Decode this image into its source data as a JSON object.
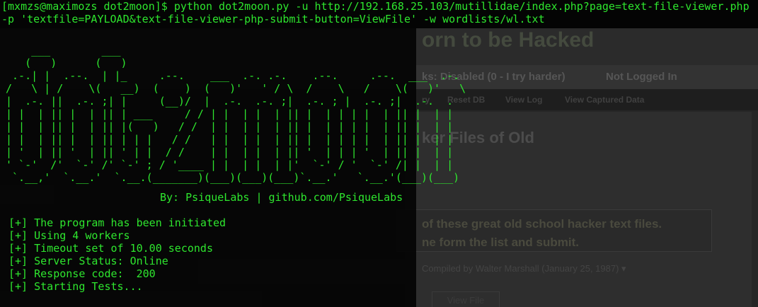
{
  "terminal": {
    "command_line_1": "[mxmzs@maximozs dot2moon]$ python dot2moon.py -u http://192.168.25.103/mutillidae/index.php?page=text-file-viewer.php",
    "command_line_2": "-p 'textfile=PAYLOAD&text-file-viewer-php-submit-button=ViewFile' -w wordlists/wl.txt",
    "banner": [
      "    ___        ___",
      "   (   )      (   )",
      " .-.| |  .--.  | |_     .--.    ___  .-. .-.    .--.     .--.  ___  .-.",
      "/   \\ | /    \\(   __)  (    )  (   )'   ' / \\  /    \\   /    \\(   )'   \\",
      "|  .-. ||  .-. ;| |     (__)/  |  .-.  .-. ;|  .-. ; |  .-. ;|  .-.  .",
      "| |  | || |  | || | ___     / / | |  | |  | || |  | | | |  | || |  | |",
      "| |  | || |  | || |(   )   / /  | |  | |  | || |  | | | |  | || |  | |",
      "| |  | || |  | || | | |   / /   | |  | |  | || |  | | | |  | || |  | |",
      "| '  | || '  | || ' | |  / /    | |  | |  | || '  | | | '  | || |  | |",
      "' `-'  /'  `-' /' `-' ; / '____ | |  | |  | |'  `-' / '  `-' /| |  | |",
      " `.__,'  `.__.'  `.__.(_______)(___)(___)(___)`.__.'   `.__.'(___)(___)"
    ],
    "credit": "By: PsiqueLabs | github.com/PsiqueLabs",
    "log": [
      "[+] The program has been initiated",
      "[+] Using 4 workers",
      "[+] Timeout set of 10.00 seconds",
      "[+] Server Status: Online",
      "[+] Response code:  200",
      "[+] Starting Tests..."
    ]
  },
  "webpage": {
    "site_title": "orn to be Hacked",
    "security_level": "ks: Disabled (0 - I try harder)",
    "login_status": "Not Logged In",
    "nav": [
      "ry",
      "Reset DB",
      "View Log",
      "View Captured Data"
    ],
    "page_heading": "ker Files of Old",
    "info_text": [
      "of these great old school hacker text files.",
      "ne form the list and submit."
    ],
    "file_select_value": "Compiled by Walter Marshall (January 25, 1987) ▾",
    "view_button": "View File"
  },
  "colors": {
    "terminal_green": "#2ee62e",
    "terminal_bg": "#040404",
    "page_dim_bg": "#262626"
  }
}
